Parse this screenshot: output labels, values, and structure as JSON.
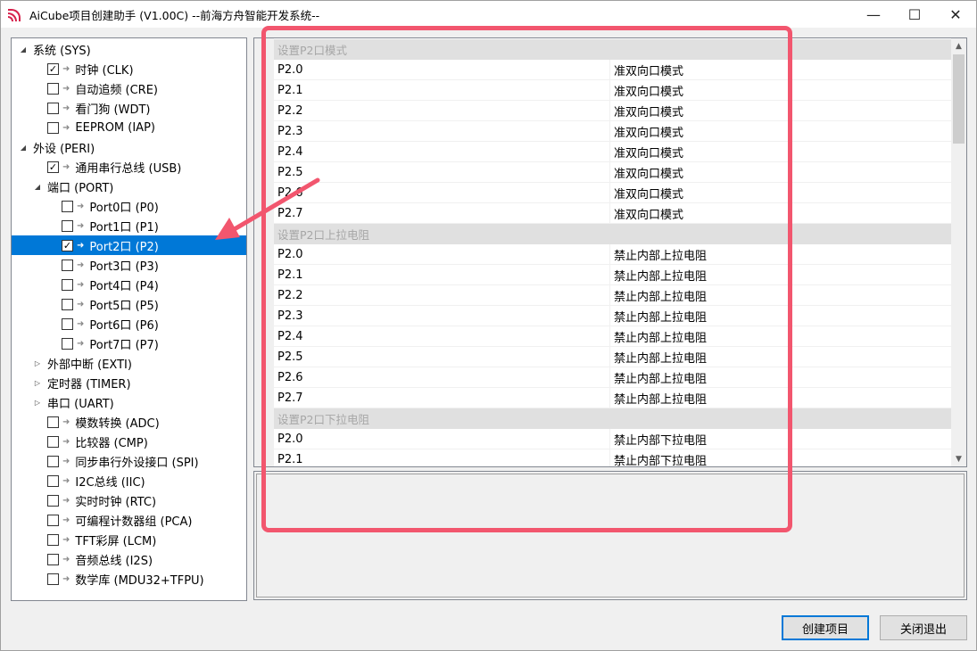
{
  "window": {
    "title": "AiCube项目创建助手 (V1.00C) --前海方舟智能开发系统--",
    "controls": [
      "—",
      "☐",
      "✕"
    ]
  },
  "tree": [
    {
      "label": "系统 (SYS)",
      "level": 0,
      "expander": "◢",
      "checkbox": null
    },
    {
      "label": "时钟 (CLK)",
      "level": 1,
      "expander": "",
      "checkbox": true
    },
    {
      "label": "自动追频 (CRE)",
      "level": 1,
      "expander": "",
      "checkbox": false
    },
    {
      "label": "看门狗 (WDT)",
      "level": 1,
      "expander": "",
      "checkbox": false
    },
    {
      "label": "EEPROM (IAP)",
      "level": 1,
      "expander": "",
      "checkbox": false
    },
    {
      "label": "外设 (PERI)",
      "level": 0,
      "expander": "◢",
      "checkbox": null
    },
    {
      "label": "通用串行总线 (USB)",
      "level": 1,
      "expander": "",
      "checkbox": true
    },
    {
      "label": "端口 (PORT)",
      "level": 1,
      "expander": "◢",
      "checkbox": null
    },
    {
      "label": "Port0口 (P0)",
      "level": 2,
      "expander": "",
      "checkbox": false
    },
    {
      "label": "Port1口 (P1)",
      "level": 2,
      "expander": "",
      "checkbox": false
    },
    {
      "label": "Port2口 (P2)",
      "level": 2,
      "expander": "",
      "checkbox": true,
      "selected": true
    },
    {
      "label": "Port3口 (P3)",
      "level": 2,
      "expander": "",
      "checkbox": false
    },
    {
      "label": "Port4口 (P4)",
      "level": 2,
      "expander": "",
      "checkbox": false
    },
    {
      "label": "Port5口 (P5)",
      "level": 2,
      "expander": "",
      "checkbox": false
    },
    {
      "label": "Port6口 (P6)",
      "level": 2,
      "expander": "",
      "checkbox": false
    },
    {
      "label": "Port7口 (P7)",
      "level": 2,
      "expander": "",
      "checkbox": false
    },
    {
      "label": "外部中断 (EXTI)",
      "level": 1,
      "expander": "▷",
      "checkbox": null
    },
    {
      "label": "定时器 (TIMER)",
      "level": 1,
      "expander": "▷",
      "checkbox": null
    },
    {
      "label": "串口 (UART)",
      "level": 1,
      "expander": "▷",
      "checkbox": null
    },
    {
      "label": "模数转换 (ADC)",
      "level": 1,
      "expander": "",
      "checkbox": false
    },
    {
      "label": "比较器 (CMP)",
      "level": 1,
      "expander": "",
      "checkbox": false
    },
    {
      "label": "同步串行外设接口 (SPI)",
      "level": 1,
      "expander": "",
      "checkbox": false
    },
    {
      "label": "I2C总线 (IIC)",
      "level": 1,
      "expander": "",
      "checkbox": false
    },
    {
      "label": "实时时钟 (RTC)",
      "level": 1,
      "expander": "",
      "checkbox": false
    },
    {
      "label": "可编程计数器组 (PCA)",
      "level": 1,
      "expander": "",
      "checkbox": false
    },
    {
      "label": "TFT彩屏 (LCM)",
      "level": 1,
      "expander": "",
      "checkbox": false
    },
    {
      "label": "音频总线 (I2S)",
      "level": 1,
      "expander": "",
      "checkbox": false
    },
    {
      "label": "数学库 (MDU32+TFPU)",
      "level": 1,
      "expander": "",
      "checkbox": false
    }
  ],
  "grid": [
    {
      "type": "category",
      "label": "设置P2口模式"
    },
    {
      "type": "prop",
      "name": "P2.0",
      "value": "准双向口模式"
    },
    {
      "type": "prop",
      "name": "P2.1",
      "value": "准双向口模式"
    },
    {
      "type": "prop",
      "name": "P2.2",
      "value": "准双向口模式"
    },
    {
      "type": "prop",
      "name": "P2.3",
      "value": "准双向口模式"
    },
    {
      "type": "prop",
      "name": "P2.4",
      "value": "准双向口模式"
    },
    {
      "type": "prop",
      "name": "P2.5",
      "value": "准双向口模式"
    },
    {
      "type": "prop",
      "name": "P2.6",
      "value": "准双向口模式"
    },
    {
      "type": "prop",
      "name": "P2.7",
      "value": "准双向口模式"
    },
    {
      "type": "category",
      "label": "设置P2口上拉电阻"
    },
    {
      "type": "prop",
      "name": "P2.0",
      "value": "禁止内部上拉电阻"
    },
    {
      "type": "prop",
      "name": "P2.1",
      "value": "禁止内部上拉电阻"
    },
    {
      "type": "prop",
      "name": "P2.2",
      "value": "禁止内部上拉电阻"
    },
    {
      "type": "prop",
      "name": "P2.3",
      "value": "禁止内部上拉电阻"
    },
    {
      "type": "prop",
      "name": "P2.4",
      "value": "禁止内部上拉电阻"
    },
    {
      "type": "prop",
      "name": "P2.5",
      "value": "禁止内部上拉电阻"
    },
    {
      "type": "prop",
      "name": "P2.6",
      "value": "禁止内部上拉电阻"
    },
    {
      "type": "prop",
      "name": "P2.7",
      "value": "禁止内部上拉电阻"
    },
    {
      "type": "category",
      "label": "设置P2口下拉电阻"
    },
    {
      "type": "prop",
      "name": "P2.0",
      "value": "禁止内部下拉电阻"
    },
    {
      "type": "prop",
      "name": "P2.1",
      "value": "禁止内部下拉电阻"
    }
  ],
  "buttons": {
    "create": "创建项目",
    "exit": "关闭退出"
  },
  "colors": {
    "selection": "#0078d7",
    "annotation": "#f2566e"
  }
}
